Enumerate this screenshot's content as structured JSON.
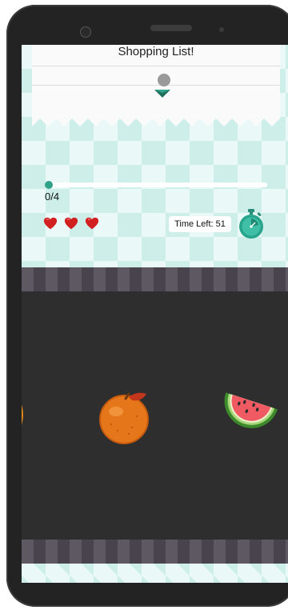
{
  "game": {
    "shopping_list_title": "Shopping List!",
    "progress": {
      "text": "0/4",
      "collected": 0,
      "total": 4
    },
    "lives": {
      "count": 3,
      "icon": "heart-icon",
      "color": "#d21f1f"
    },
    "time_left_text": "Time Left: 51",
    "timer_icon": "stopwatch-icon",
    "fruits": [
      {
        "name": "pumpkin",
        "icon": "pumpkin-icon"
      },
      {
        "name": "orange",
        "icon": "orange-icon"
      },
      {
        "name": "watermelon",
        "icon": "watermelon-icon"
      }
    ]
  },
  "colors": {
    "accent": "#2fa28a",
    "conveyor": "#2e2e2e",
    "band": "#5e5863",
    "background_tile": "#cdeee9"
  }
}
